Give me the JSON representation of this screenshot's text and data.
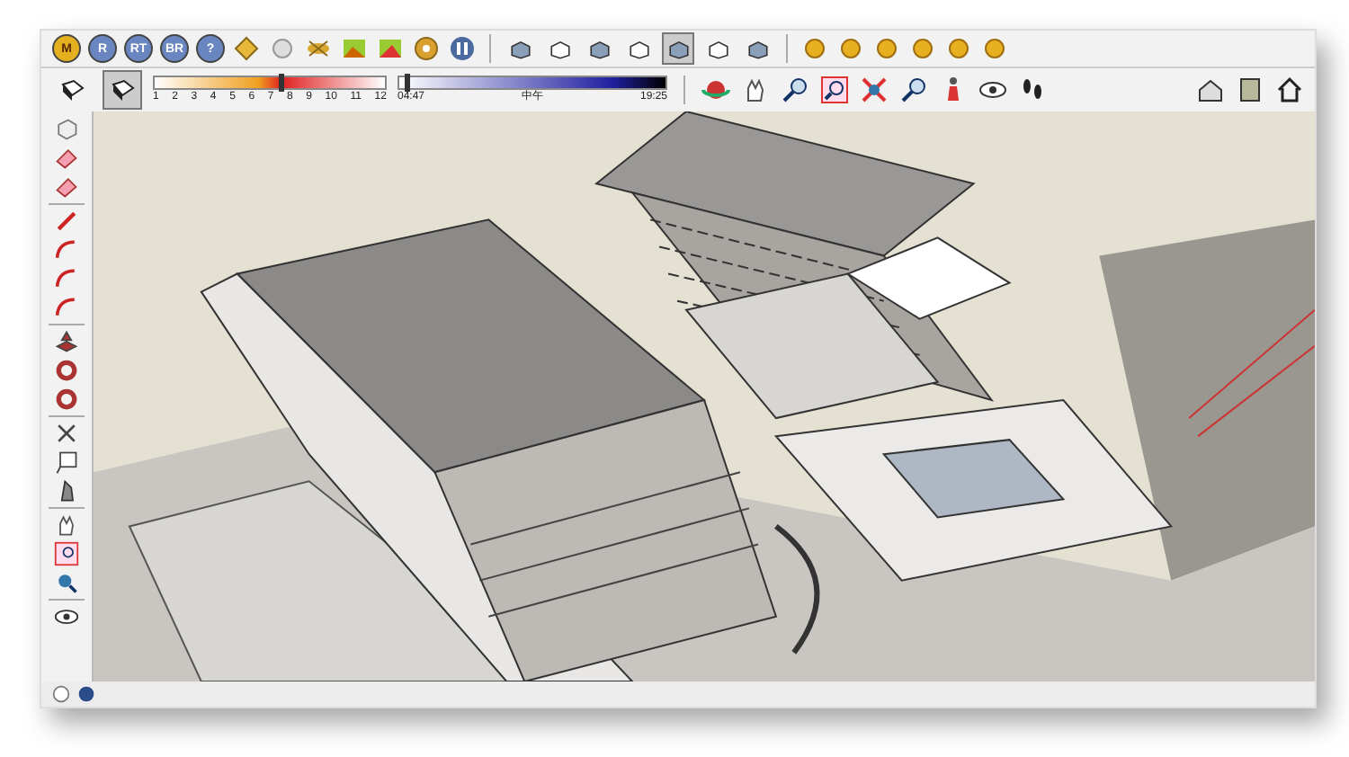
{
  "toolbar": {
    "letter_buttons": [
      {
        "label": "M",
        "kind": "gold"
      },
      {
        "label": "R",
        "kind": "blue"
      },
      {
        "label": "RT",
        "kind": "blue"
      },
      {
        "label": "BR",
        "kind": "blue"
      },
      {
        "label": "?",
        "kind": "blue"
      }
    ],
    "face_style_buttons": [
      {
        "selected": false
      },
      {
        "selected": false
      },
      {
        "selected": false
      },
      {
        "selected": false
      },
      {
        "selected": true
      },
      {
        "selected": false
      },
      {
        "selected": false
      }
    ]
  },
  "shadow_bar": {
    "style_buttons": [
      {
        "selected": false
      },
      {
        "selected": true
      }
    ],
    "month_slider": {
      "level": 0.55
    },
    "time_slider": {
      "level": 0.03
    },
    "months": [
      "1",
      "2",
      "3",
      "4",
      "5",
      "6",
      "7",
      "8",
      "9",
      "10",
      "11",
      "12"
    ],
    "time_start": "04:47",
    "time_mid": "中午",
    "time_end": "19:25"
  }
}
